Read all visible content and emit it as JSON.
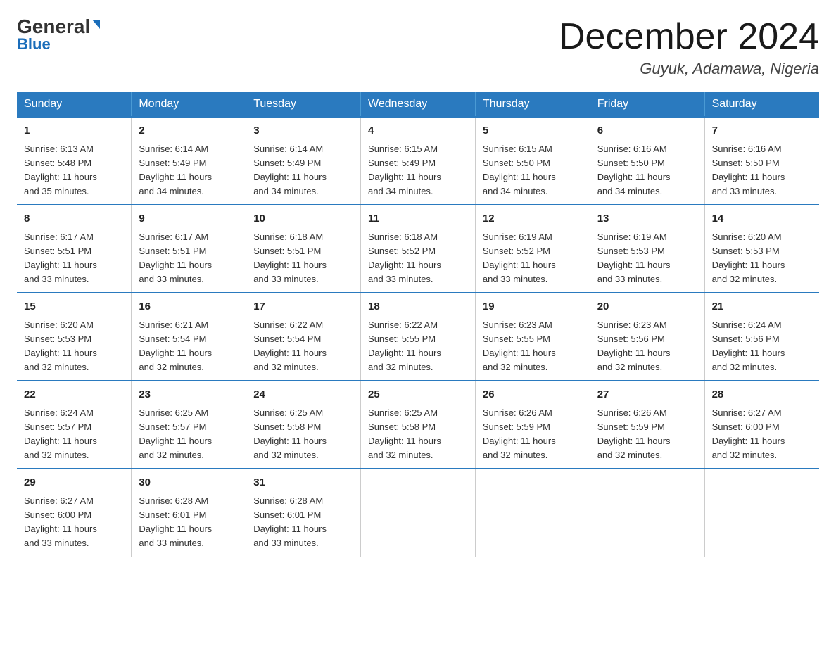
{
  "logo": {
    "general": "General",
    "blue": "Blue"
  },
  "header": {
    "month_title": "December 2024",
    "location": "Guyuk, Adamawa, Nigeria"
  },
  "days_of_week": [
    "Sunday",
    "Monday",
    "Tuesday",
    "Wednesday",
    "Thursday",
    "Friday",
    "Saturday"
  ],
  "weeks": [
    [
      {
        "day": "1",
        "sunrise": "6:13 AM",
        "sunset": "5:48 PM",
        "daylight": "11 hours and 35 minutes."
      },
      {
        "day": "2",
        "sunrise": "6:14 AM",
        "sunset": "5:49 PM",
        "daylight": "11 hours and 34 minutes."
      },
      {
        "day": "3",
        "sunrise": "6:14 AM",
        "sunset": "5:49 PM",
        "daylight": "11 hours and 34 minutes."
      },
      {
        "day": "4",
        "sunrise": "6:15 AM",
        "sunset": "5:49 PM",
        "daylight": "11 hours and 34 minutes."
      },
      {
        "day": "5",
        "sunrise": "6:15 AM",
        "sunset": "5:50 PM",
        "daylight": "11 hours and 34 minutes."
      },
      {
        "day": "6",
        "sunrise": "6:16 AM",
        "sunset": "5:50 PM",
        "daylight": "11 hours and 34 minutes."
      },
      {
        "day": "7",
        "sunrise": "6:16 AM",
        "sunset": "5:50 PM",
        "daylight": "11 hours and 33 minutes."
      }
    ],
    [
      {
        "day": "8",
        "sunrise": "6:17 AM",
        "sunset": "5:51 PM",
        "daylight": "11 hours and 33 minutes."
      },
      {
        "day": "9",
        "sunrise": "6:17 AM",
        "sunset": "5:51 PM",
        "daylight": "11 hours and 33 minutes."
      },
      {
        "day": "10",
        "sunrise": "6:18 AM",
        "sunset": "5:51 PM",
        "daylight": "11 hours and 33 minutes."
      },
      {
        "day": "11",
        "sunrise": "6:18 AM",
        "sunset": "5:52 PM",
        "daylight": "11 hours and 33 minutes."
      },
      {
        "day": "12",
        "sunrise": "6:19 AM",
        "sunset": "5:52 PM",
        "daylight": "11 hours and 33 minutes."
      },
      {
        "day": "13",
        "sunrise": "6:19 AM",
        "sunset": "5:53 PM",
        "daylight": "11 hours and 33 minutes."
      },
      {
        "day": "14",
        "sunrise": "6:20 AM",
        "sunset": "5:53 PM",
        "daylight": "11 hours and 32 minutes."
      }
    ],
    [
      {
        "day": "15",
        "sunrise": "6:20 AM",
        "sunset": "5:53 PM",
        "daylight": "11 hours and 32 minutes."
      },
      {
        "day": "16",
        "sunrise": "6:21 AM",
        "sunset": "5:54 PM",
        "daylight": "11 hours and 32 minutes."
      },
      {
        "day": "17",
        "sunrise": "6:22 AM",
        "sunset": "5:54 PM",
        "daylight": "11 hours and 32 minutes."
      },
      {
        "day": "18",
        "sunrise": "6:22 AM",
        "sunset": "5:55 PM",
        "daylight": "11 hours and 32 minutes."
      },
      {
        "day": "19",
        "sunrise": "6:23 AM",
        "sunset": "5:55 PM",
        "daylight": "11 hours and 32 minutes."
      },
      {
        "day": "20",
        "sunrise": "6:23 AM",
        "sunset": "5:56 PM",
        "daylight": "11 hours and 32 minutes."
      },
      {
        "day": "21",
        "sunrise": "6:24 AM",
        "sunset": "5:56 PM",
        "daylight": "11 hours and 32 minutes."
      }
    ],
    [
      {
        "day": "22",
        "sunrise": "6:24 AM",
        "sunset": "5:57 PM",
        "daylight": "11 hours and 32 minutes."
      },
      {
        "day": "23",
        "sunrise": "6:25 AM",
        "sunset": "5:57 PM",
        "daylight": "11 hours and 32 minutes."
      },
      {
        "day": "24",
        "sunrise": "6:25 AM",
        "sunset": "5:58 PM",
        "daylight": "11 hours and 32 minutes."
      },
      {
        "day": "25",
        "sunrise": "6:25 AM",
        "sunset": "5:58 PM",
        "daylight": "11 hours and 32 minutes."
      },
      {
        "day": "26",
        "sunrise": "6:26 AM",
        "sunset": "5:59 PM",
        "daylight": "11 hours and 32 minutes."
      },
      {
        "day": "27",
        "sunrise": "6:26 AM",
        "sunset": "5:59 PM",
        "daylight": "11 hours and 32 minutes."
      },
      {
        "day": "28",
        "sunrise": "6:27 AM",
        "sunset": "6:00 PM",
        "daylight": "11 hours and 32 minutes."
      }
    ],
    [
      {
        "day": "29",
        "sunrise": "6:27 AM",
        "sunset": "6:00 PM",
        "daylight": "11 hours and 33 minutes."
      },
      {
        "day": "30",
        "sunrise": "6:28 AM",
        "sunset": "6:01 PM",
        "daylight": "11 hours and 33 minutes."
      },
      {
        "day": "31",
        "sunrise": "6:28 AM",
        "sunset": "6:01 PM",
        "daylight": "11 hours and 33 minutes."
      },
      null,
      null,
      null,
      null
    ]
  ],
  "labels": {
    "sunrise": "Sunrise:",
    "sunset": "Sunset:",
    "daylight": "Daylight:"
  }
}
